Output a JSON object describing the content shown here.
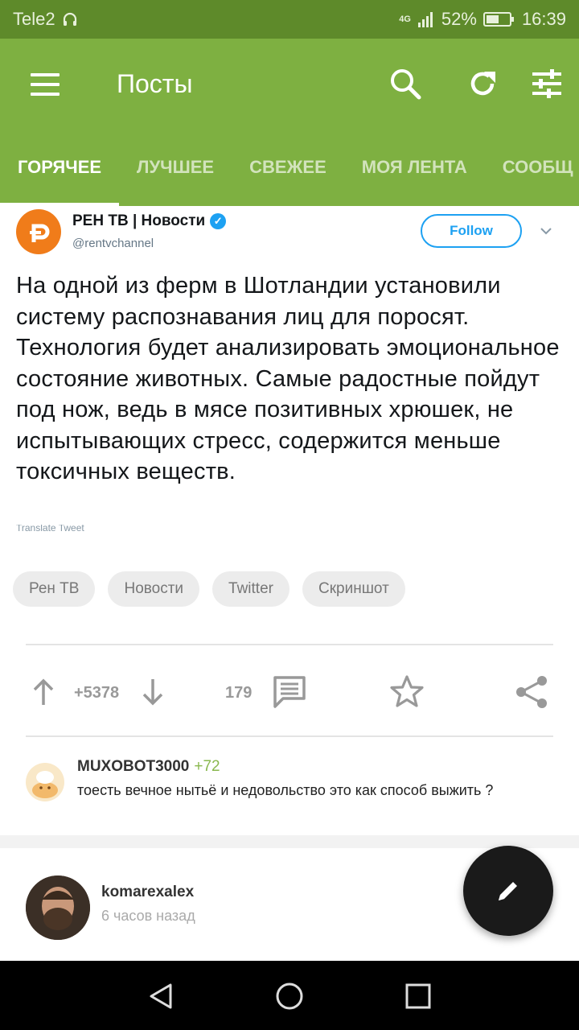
{
  "status_bar": {
    "carrier": "Tele2",
    "network": "4G",
    "battery": "52%",
    "time": "16:39"
  },
  "app_bar": {
    "title": "Посты"
  },
  "tabs": [
    "ГОРЯЧЕЕ",
    "ЛУЧШЕЕ",
    "СВЕЖЕЕ",
    "МОЯ ЛЕНТА",
    "СООБЩ"
  ],
  "tweet": {
    "name": "РЕН ТВ | Новости",
    "handle": "@rentvchannel",
    "follow_label": "Follow",
    "text": "На одной из ферм в Шотландии установили систему распознавания лиц для поросят. Технология будет анализировать эмоциональное состояние животных. Самые радостные пойдут под нож, ведь в мясе позитивных хрюшек, не испытывающих стресс, содержится меньше токсичных веществ.",
    "translate_label": "Translate Tweet"
  },
  "tags": [
    "Рен ТВ",
    "Новости",
    "Twitter",
    "Скриншот"
  ],
  "actions": {
    "rating": "+5378",
    "comments_count": "179"
  },
  "top_comment": {
    "author": "MUXOBOT3000",
    "score": "+72",
    "text": "тоесть вечное нытьё и недовольство это как способ выжить ?"
  },
  "next_post": {
    "author": "komarexalex",
    "time": "6 часов назад"
  },
  "colors": {
    "accent": "#7eb041",
    "status_bar": "#5e8a2a",
    "twitter_blue": "#1da1f2",
    "score_green": "#8ab84f"
  }
}
